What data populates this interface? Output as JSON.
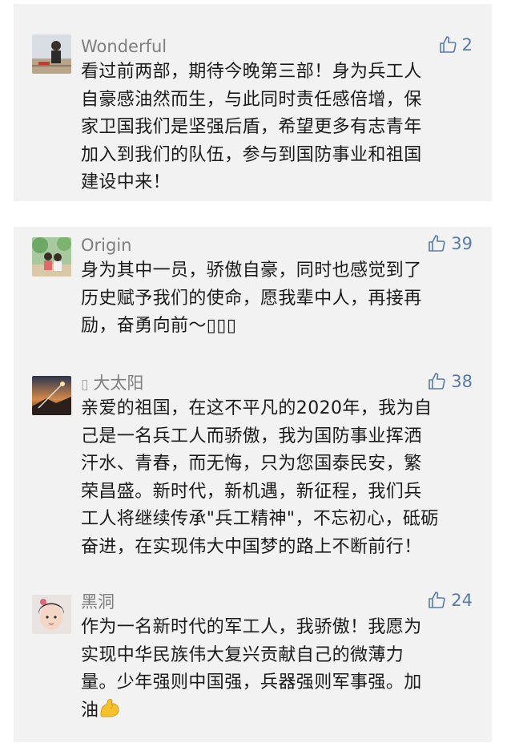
{
  "comments": [
    {
      "name": "Wonderful",
      "likes": "2",
      "lines": [
        "看过前两部，期待今晚第三部！身为兵工人",
        "自豪感油然而生，与此同时责任感倍增，保",
        "家卫国我们是坚强后盾，希望更多有志青年",
        "加入到我们的队伍，参与到国防事业和祖国",
        "建设中来！"
      ]
    },
    {
      "name": "Origin",
      "likes": "39",
      "lines": [
        "身为其中一员，骄傲自豪，同时也感觉到了",
        "历史赋予我们的使命，愿我辈中人，再接再",
        "励，奋勇向前～▯▯▯"
      ]
    },
    {
      "name_prefix": "▯",
      "name": "大太阳",
      "likes": "38",
      "lines": [
        "亲爱的祖国，在这不平凡的2020年，我为自",
        "己是一名兵工人而骄傲，我为国防事业挥洒",
        "汗水、青春，而无悔，只为您国泰民安，繁",
        "荣昌盛。新时代，新机遇，新征程，我们兵",
        "工人将继续传承\"兵工精神\"，不忘初心，砥砺",
        "奋进，在实现伟大中国梦的路上不断前行！"
      ]
    },
    {
      "name": "黑洞",
      "likes": "24",
      "lines": [
        "作为一名新时代的军工人，我骄傲！我愿为",
        "实现中华民族伟大复兴贡献自己的微薄力",
        "量。少年强则中国强，兵器强则军事强。加",
        "油"
      ],
      "trailing_icon": "flexed-biceps-icon"
    }
  ],
  "icons": {
    "like": "thumbs-up-icon"
  },
  "colors": {
    "card_bg": "#f2f2f2",
    "name": "#7f7f7f",
    "like": "#5a7ba6",
    "text": "#1a1a1a"
  }
}
